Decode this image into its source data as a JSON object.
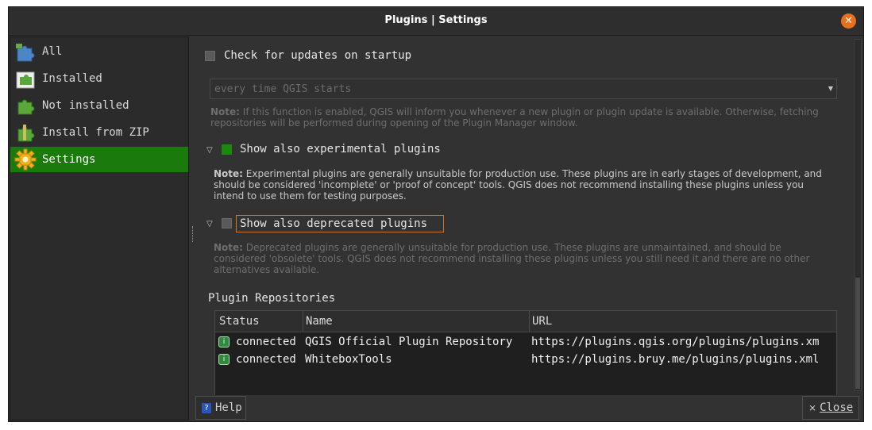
{
  "window": {
    "title": "Plugins | Settings"
  },
  "sidebar": {
    "items": [
      {
        "label": "All",
        "icon": "puzzle-all-icon"
      },
      {
        "label": "Installed",
        "icon": "puzzle-installed-icon"
      },
      {
        "label": "Not installed",
        "icon": "puzzle-not-installed-icon"
      },
      {
        "label": "Install from ZIP",
        "icon": "puzzle-zip-icon"
      },
      {
        "label": "Settings",
        "icon": "gear-icon",
        "active": true
      }
    ]
  },
  "settings": {
    "check_updates": {
      "label": "Check for updates on startup",
      "checked": false,
      "frequency": "every time QGIS starts",
      "note_bold": "Note:",
      "note_text": "If this function is enabled, QGIS will inform you whenever a new plugin or plugin update is available. Otherwise, fetching repositories will be performed during opening of the Plugin Manager window."
    },
    "experimental": {
      "label": "Show also experimental plugins",
      "checked": true,
      "note_bold": "Note:",
      "note_text": "Experimental plugins are generally unsuitable for production use. These plugins are in early stages of development, and should be considered 'incomplete' or 'proof of concept' tools. QGIS does not recommend installing these plugins unless you intend to use them for testing purposes."
    },
    "deprecated": {
      "label": "Show also deprecated plugins",
      "checked": false,
      "note_bold": "Note:",
      "note_text": "Deprecated plugins are generally unsuitable for production use. These plugins are unmaintained, and should be considered 'obsolete' tools. QGIS does not recommend installing these plugins unless you still need it and there are no other alternatives available."
    },
    "repositories": {
      "title": "Plugin Repositories",
      "columns": [
        "Status",
        "Name",
        "URL"
      ],
      "rows": [
        {
          "status": "connected",
          "name": "QGIS Official Plugin Repository",
          "url": "https://plugins.qgis.org/plugins/plugins.xm"
        },
        {
          "status": "connected",
          "name": "WhiteboxTools",
          "url": "https://plugins.bruy.me/plugins/plugins.xml"
        }
      ]
    }
  },
  "buttons": {
    "help": "Help",
    "close": "Close"
  },
  "colors": {
    "accent": "#1a7a0c",
    "close_orange": "#e8701a"
  }
}
